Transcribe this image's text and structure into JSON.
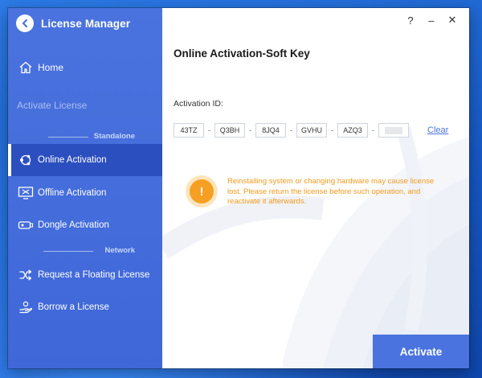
{
  "app": {
    "title": "License Manager"
  },
  "colors": {
    "sidebar": "#4a73df",
    "sidebar_active": "#2c4fc0",
    "accent": "#4a73df",
    "warning": "#f5a022"
  },
  "sidebar": {
    "home": {
      "label": "Home",
      "icon": "home-icon"
    },
    "section_title": "Activate License",
    "groups": [
      {
        "label": "Standalone"
      },
      {
        "label": "Network"
      }
    ],
    "items": [
      {
        "label": "Online Activation",
        "icon": "online-activation-icon",
        "active": true
      },
      {
        "label": "Offline Activation",
        "icon": "offline-activation-icon"
      },
      {
        "label": "Dongle Activation",
        "icon": "dongle-icon"
      },
      {
        "label": "Request a Floating License",
        "icon": "shuffle-icon"
      },
      {
        "label": "Borrow a License",
        "icon": "borrow-hand-icon"
      }
    ]
  },
  "window_controls": {
    "help": "?",
    "minimize": "–",
    "close": "✕"
  },
  "main": {
    "title": "Online Activation-Soft Key",
    "activation_id_label": "Activation ID:",
    "key_segments": [
      "43TZ",
      "Q3BH",
      "8JQ4",
      "GVHU",
      "AZQ3",
      ""
    ],
    "separator": "-",
    "clear_label": "Clear",
    "warning_symbol": "!",
    "warning_text": "Reinstalling system or changing hardware may cause license lost. Please return the license before such operation, and reactivate it afterwards.",
    "activate_label": "Activate"
  }
}
